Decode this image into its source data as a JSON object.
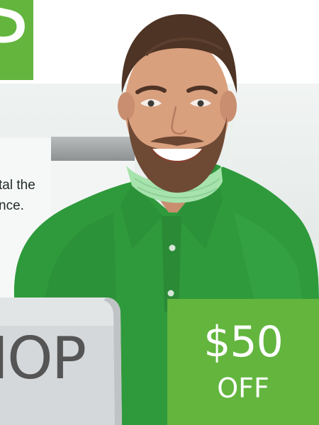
{
  "logo": {
    "glyph": "S"
  },
  "tagline": {
    "line1": "tal the",
    "line2": "nce."
  },
  "laptop": {
    "word": "IOP"
  },
  "badge": {
    "amount": "$50",
    "label": "OFF"
  },
  "colors": {
    "brand_green": "#63b53e",
    "shirt_green": "#2f9a3c",
    "text_dark": "#1f2a26",
    "laptop_text": "#555555"
  },
  "icons": [
    "laptop-icon",
    "surgical-mask-icon"
  ]
}
